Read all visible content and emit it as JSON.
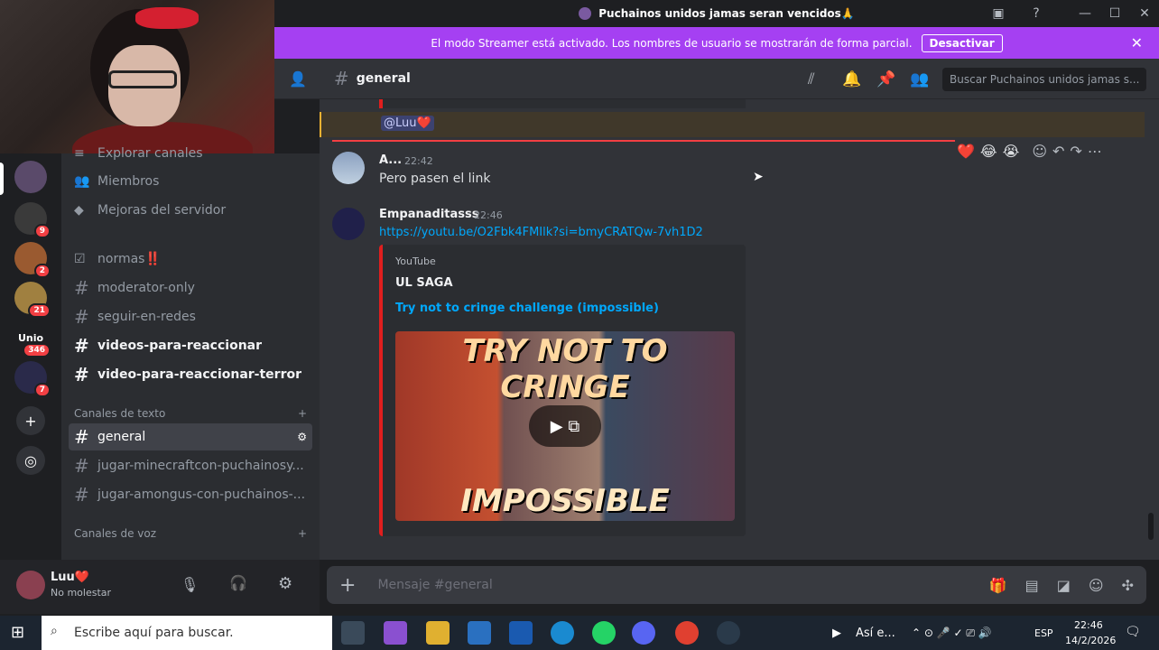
{
  "window": {
    "title": "Puchainos unidos jamas seran vencidos🙏",
    "controls": [
      "—",
      "☐",
      "✕"
    ]
  },
  "streamer_banner": {
    "text": "El modo Streamer está activado. Los nombres de usuario se mostrarán de forma parcial.",
    "button": "Desactivar"
  },
  "sidebar": {
    "partial_top": "Explorar canales",
    "items": [
      {
        "label": "Miembros",
        "icon": "members-icon"
      },
      {
        "label": "Mejoras del servidor",
        "icon": "boost-icon"
      }
    ],
    "channels_top": [
      {
        "label": "normas‼️",
        "bold": false
      },
      {
        "label": "moderator-only",
        "bold": false
      },
      {
        "label": "seguir-en-redes",
        "bold": false
      },
      {
        "label": "videos-para-reaccionar",
        "bold": true
      },
      {
        "label": "video-para-reaccionar-terror",
        "bold": true
      }
    ],
    "text_category": "Canales de texto",
    "text_channels": [
      {
        "label": "general",
        "selected": true
      },
      {
        "label": "jugar-minecraftcon-puchainosy...",
        "selected": false
      },
      {
        "label": "jugar-amongus-con-puchainos-...",
        "selected": false
      }
    ],
    "voice_category": "Canales de voz"
  },
  "servers": {
    "badges": [
      "9",
      "2",
      "21",
      "346",
      "7"
    ],
    "partial_label": "Unio"
  },
  "user": {
    "name": "Luu❤️",
    "status": "No molestar"
  },
  "header": {
    "channel": "general",
    "search_placeholder": "Buscar Puchainos unidos jamas s..."
  },
  "messages": {
    "mention": "@Luu❤️",
    "msg1": {
      "author": "A...",
      "time": "22:42",
      "text": "Pero pasen el link"
    },
    "msg2": {
      "author": "Empanaditasss",
      "time": "22:46",
      "link": "https://youtu.be/O2Fbk4FMIlk?si=bmyCRATQw-7vh1D2",
      "embed_provider": "YouTube",
      "embed_author": "UL SAGA",
      "embed_title": "Try not to cringe challenge (impossible)",
      "thumb_top": "TRY NOT TO CRINGE",
      "thumb_bottom": "IMPOSSIBLE"
    }
  },
  "reactions": [
    "❤️",
    "😂",
    "😭"
  ],
  "input": {
    "placeholder": "Mensaje #general"
  },
  "taskbar": {
    "search": "Escribe aquí para buscar.",
    "media": "Así e...",
    "lang": "ESP",
    "time": "22:46",
    "date": "14/2/2026"
  }
}
